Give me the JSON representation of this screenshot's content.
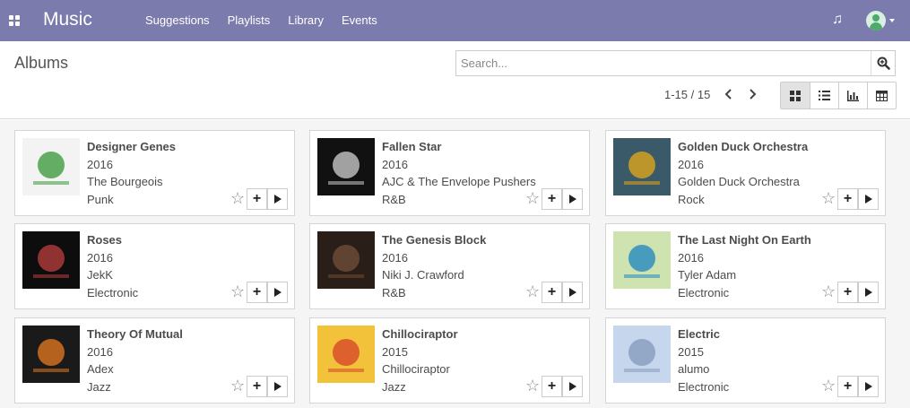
{
  "app": {
    "brand": "Music",
    "menu": [
      "Suggestions",
      "Playlists",
      "Library",
      "Events"
    ]
  },
  "control": {
    "title": "Albums",
    "search_placeholder": "Search...",
    "pager": "1-15 / 15",
    "active_view": "kanban"
  },
  "albums": [
    {
      "title": "Designer Genes",
      "year": "2016",
      "artist": "The Bourgeois",
      "genre": "Punk",
      "cover": {
        "bg": "#f3f3f3",
        "accent": "#4aa04a"
      }
    },
    {
      "title": "Fallen Star",
      "year": "2016",
      "artist": "AJC & The Envelope Pushers",
      "genre": "R&B",
      "cover": {
        "bg": "#111111",
        "accent": "#bbbbbb"
      }
    },
    {
      "title": "Golden Duck Orchestra",
      "year": "2016",
      "artist": "Golden Duck Orchestra",
      "genre": "Rock",
      "cover": {
        "bg": "#3a5a6a",
        "accent": "#d4a020"
      }
    },
    {
      "title": "Roses",
      "year": "2016",
      "artist": "JekK",
      "genre": "Electronic",
      "cover": {
        "bg": "#0d0d0d",
        "accent": "#a83a3a"
      }
    },
    {
      "title": "The Genesis Block",
      "year": "2016",
      "artist": "Niki J. Crawford",
      "genre": "R&B",
      "cover": {
        "bg": "#2a1e18",
        "accent": "#6b4a36"
      }
    },
    {
      "title": "The Last Night On Earth",
      "year": "2016",
      "artist": "Tyler Adam",
      "genre": "Electronic",
      "cover": {
        "bg": "#cfe3b0",
        "accent": "#2f8fbf"
      }
    },
    {
      "title": "Theory Of Mutual",
      "year": "2016",
      "artist": "Adex",
      "genre": "Jazz",
      "cover": {
        "bg": "#1a1a1a",
        "accent": "#d07020"
      }
    },
    {
      "title": "Chillociraptor",
      "year": "2015",
      "artist": "Chillociraptor",
      "genre": "Jazz",
      "cover": {
        "bg": "#f2c23a",
        "accent": "#d8502a"
      }
    },
    {
      "title": "Electric",
      "year": "2015",
      "artist": "alumo",
      "genre": "Electronic",
      "cover": {
        "bg": "#c6d6ec",
        "accent": "#8aa0c0"
      }
    }
  ]
}
